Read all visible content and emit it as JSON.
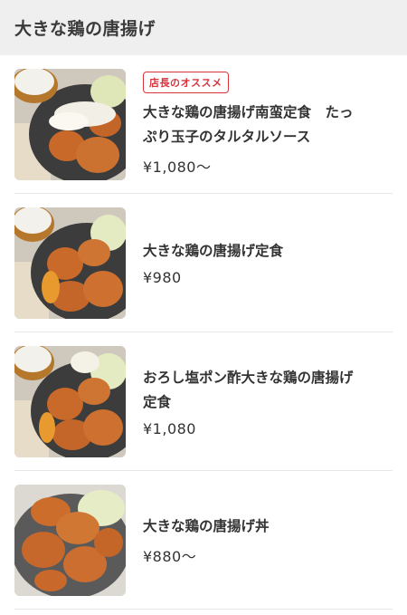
{
  "header": {
    "title": "大きな鶏の唐揚げ"
  },
  "items": [
    {
      "badge": "店長のオススメ",
      "name": "大きな鶏の唐揚げ南蛮定食　たっぷり玉子のタルタルソース",
      "price": "¥1,080〜"
    },
    {
      "name": "大きな鶏の唐揚げ定食",
      "price": "¥980"
    },
    {
      "name": "おろし塩ポン酢大きな鶏の唐揚げ定食",
      "price": "¥1,080"
    },
    {
      "name": "大きな鶏の唐揚げ丼",
      "price": "¥880〜"
    }
  ]
}
